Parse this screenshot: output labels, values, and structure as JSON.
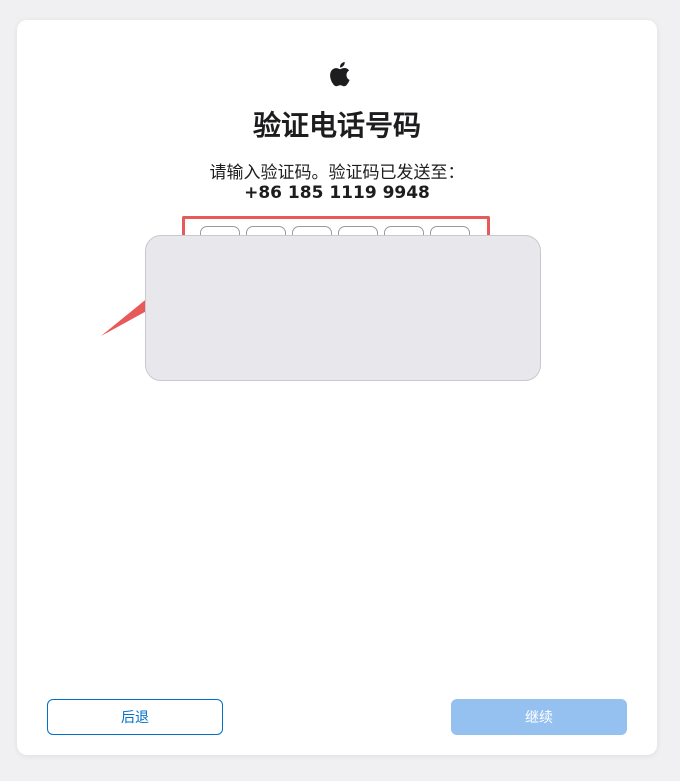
{
  "header": {
    "logo_icon": "apple-logo-icon",
    "title": "验证电话号码",
    "subtitle": "请输入验证码。验证码已发送至：",
    "phone_number": "+86 185 1119 9948"
  },
  "code_input": {
    "digits": [
      "",
      "",
      "",
      "",
      "",
      ""
    ],
    "highlight_color": "#e85a5a"
  },
  "popup": {
    "background": "#e8e8ec"
  },
  "footer": {
    "back_label": "后退",
    "continue_label": "继续",
    "accent_color": "#0070c9",
    "disabled_color": "#94c1f0"
  }
}
